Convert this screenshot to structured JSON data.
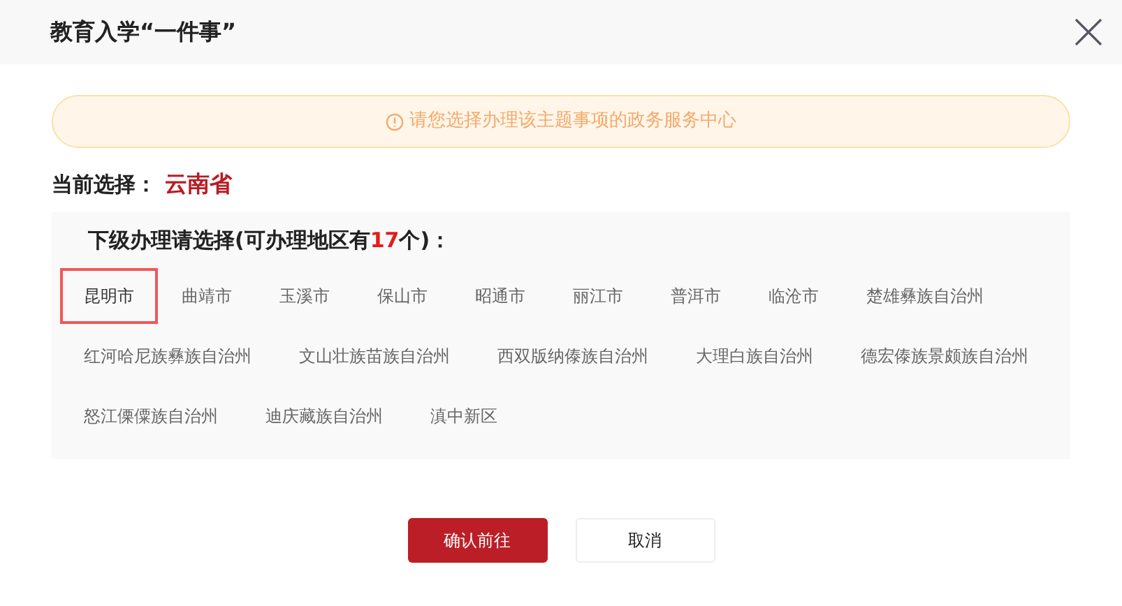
{
  "dialog": {
    "title": "教育入学“一件事”"
  },
  "notice": {
    "text": "请您选择办理该主题事项的政务服务中心"
  },
  "current": {
    "label": "当前选择：",
    "value": "云南省"
  },
  "regions_panel": {
    "heading_prefix": "下级办理请选择(可办理地区有",
    "count": "17",
    "heading_suffix": "个)：",
    "items": [
      {
        "label": "昆明市",
        "selected": true
      },
      {
        "label": "曲靖市",
        "selected": false
      },
      {
        "label": "玉溪市",
        "selected": false
      },
      {
        "label": "保山市",
        "selected": false
      },
      {
        "label": "昭通市",
        "selected": false
      },
      {
        "label": "丽江市",
        "selected": false
      },
      {
        "label": "普洱市",
        "selected": false
      },
      {
        "label": "临沧市",
        "selected": false
      },
      {
        "label": "楚雄彝族自治州",
        "selected": false
      },
      {
        "label": "红河哈尼族彝族自治州",
        "selected": false
      },
      {
        "label": "文山壮族苗族自治州",
        "selected": false
      },
      {
        "label": "西双版纳傣族自治州",
        "selected": false
      },
      {
        "label": "大理白族自治州",
        "selected": false
      },
      {
        "label": "德宏傣族景颇族自治州",
        "selected": false
      },
      {
        "label": "怒江傈僳族自治州",
        "selected": false
      },
      {
        "label": "迪庆藏族自治州",
        "selected": false
      },
      {
        "label": "滇中新区",
        "selected": false
      }
    ]
  },
  "buttons": {
    "confirm": "确认前往",
    "cancel": "取消"
  }
}
